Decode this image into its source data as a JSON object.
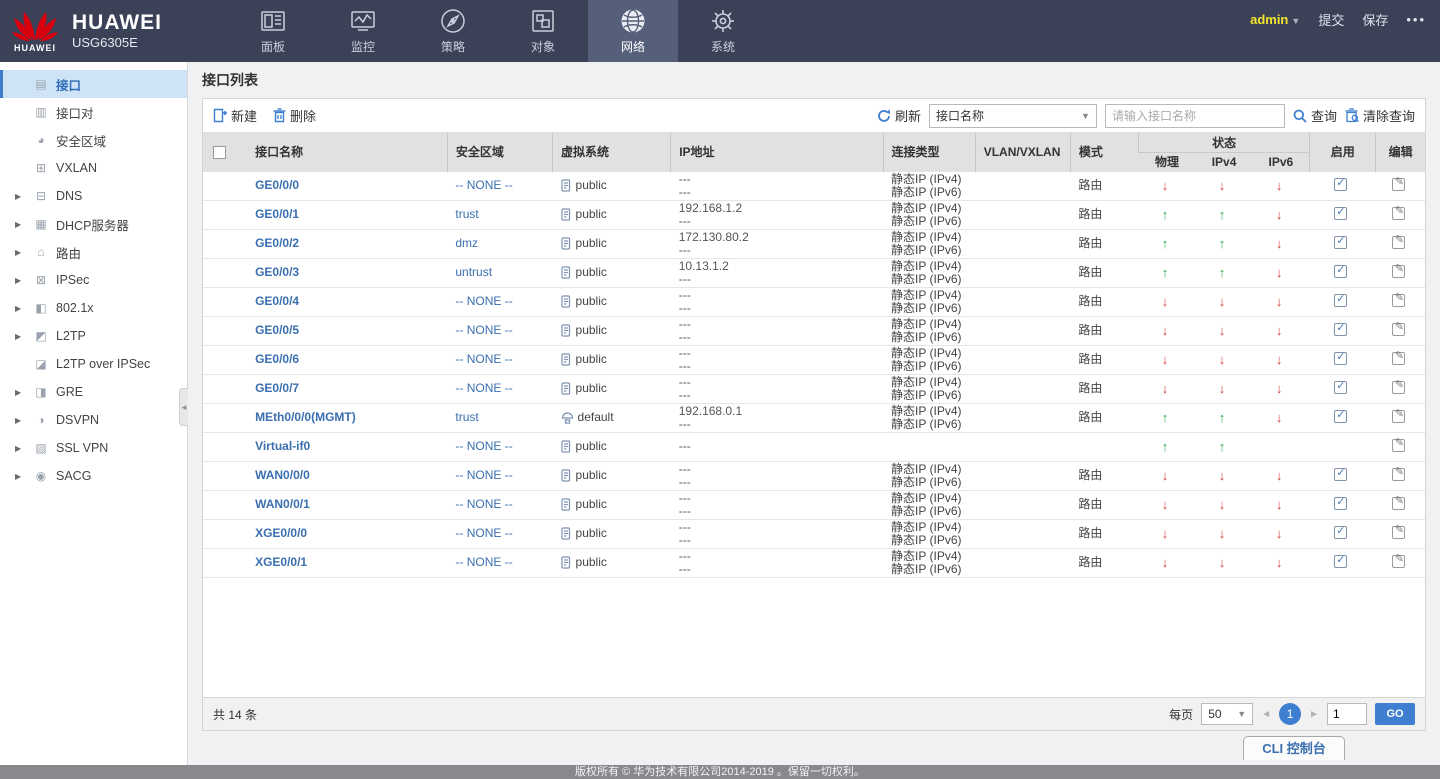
{
  "topbar": {
    "brand": "HUAWEI",
    "model": "USG6305E",
    "logo_caption": "HUAWEI",
    "nav": [
      {
        "label": "面板",
        "icon": "dashboard-icon"
      },
      {
        "label": "监控",
        "icon": "monitor-icon"
      },
      {
        "label": "策略",
        "icon": "policy-icon"
      },
      {
        "label": "对象",
        "icon": "objects-icon"
      },
      {
        "label": "网络",
        "icon": "network-icon",
        "active": true
      },
      {
        "label": "系统",
        "icon": "system-icon"
      }
    ],
    "user": "admin",
    "submit_label": "提交",
    "save_label": "保存",
    "more_label": "•••"
  },
  "sidebar": {
    "items": [
      {
        "label": "接口",
        "glyph": "▤",
        "expandable": false,
        "active": true
      },
      {
        "label": "接口对",
        "glyph": "▥",
        "expandable": false
      },
      {
        "label": "安全区域",
        "glyph": "◕",
        "expandable": false
      },
      {
        "label": "VXLAN",
        "glyph": "⊞",
        "expandable": false
      },
      {
        "label": "DNS",
        "glyph": "⊟",
        "expandable": true
      },
      {
        "label": "DHCP服务器",
        "glyph": "▦",
        "expandable": true
      },
      {
        "label": "路由",
        "glyph": "⌂",
        "expandable": true
      },
      {
        "label": "IPSec",
        "glyph": "⊠",
        "expandable": true
      },
      {
        "label": "802.1x",
        "glyph": "◧",
        "expandable": true
      },
      {
        "label": "L2TP",
        "glyph": "◩",
        "expandable": true
      },
      {
        "label": "L2TP over IPSec",
        "glyph": "◪",
        "expandable": false
      },
      {
        "label": "GRE",
        "glyph": "◨",
        "expandable": true
      },
      {
        "label": "DSVPN",
        "glyph": "◑",
        "expandable": true
      },
      {
        "label": "SSL VPN",
        "glyph": "▧",
        "expandable": true
      },
      {
        "label": "SACG",
        "glyph": "◉",
        "expandable": true
      }
    ]
  },
  "main": {
    "title": "接口列表",
    "toolbar": {
      "new_label": "新建",
      "delete_label": "删除",
      "refresh_label": "刷新",
      "filter_selected": "接口名称",
      "search_placeholder": "请输入接口名称",
      "query_label": "查询",
      "clear_label": "清除查询"
    },
    "table": {
      "col_interface": "接口名称",
      "col_zone": "安全区域",
      "col_vsys": "虚拟系统",
      "col_ip": "IP地址",
      "col_conn": "连接类型",
      "col_vlan": "VLAN/VXLAN",
      "col_mode": "模式",
      "col_status": "状态",
      "col_phy": "物理",
      "col_ipv4": "IPv4",
      "col_ipv6": "IPv6",
      "col_enable": "启用",
      "col_edit": "编辑",
      "rows": [
        {
          "name": "GE0/0/0",
          "zone": "-- NONE --",
          "vsys": "public",
          "vsys_is_public": true,
          "vsys_is_default": false,
          "ip1": "---",
          "ip2": "---",
          "conn1": "静态IP (IPv4)",
          "conn2": "静态IP (IPv6)",
          "vlan": "",
          "mode": "路由",
          "phy": "down",
          "ipv4": "down",
          "ipv6": "down",
          "enable": true
        },
        {
          "name": "GE0/0/1",
          "zone": "trust",
          "vsys": "public",
          "vsys_is_public": true,
          "vsys_is_default": false,
          "ip1": "192.168.1.2",
          "ip2": "---",
          "conn1": "静态IP (IPv4)",
          "conn2": "静态IP (IPv6)",
          "vlan": "",
          "mode": "路由",
          "phy": "up",
          "ipv4": "up",
          "ipv6": "down",
          "enable": true
        },
        {
          "name": "GE0/0/2",
          "zone": "dmz",
          "vsys": "public",
          "vsys_is_public": true,
          "vsys_is_default": false,
          "ip1": "172.130.80.2",
          "ip2": "---",
          "conn1": "静态IP (IPv4)",
          "conn2": "静态IP (IPv6)",
          "vlan": "",
          "mode": "路由",
          "phy": "up",
          "ipv4": "up",
          "ipv6": "down",
          "enable": true
        },
        {
          "name": "GE0/0/3",
          "zone": "untrust",
          "vsys": "public",
          "vsys_is_public": true,
          "vsys_is_default": false,
          "ip1": "10.13.1.2",
          "ip2": "---",
          "conn1": "静态IP (IPv4)",
          "conn2": "静态IP (IPv6)",
          "vlan": "",
          "mode": "路由",
          "phy": "up",
          "ipv4": "up",
          "ipv6": "down",
          "enable": true
        },
        {
          "name": "GE0/0/4",
          "zone": "-- NONE --",
          "vsys": "public",
          "vsys_is_public": true,
          "vsys_is_default": false,
          "ip1": "---",
          "ip2": "---",
          "conn1": "静态IP (IPv4)",
          "conn2": "静态IP (IPv6)",
          "vlan": "",
          "mode": "路由",
          "phy": "down",
          "ipv4": "down",
          "ipv6": "down",
          "enable": true
        },
        {
          "name": "GE0/0/5",
          "zone": "-- NONE --",
          "vsys": "public",
          "vsys_is_public": true,
          "vsys_is_default": false,
          "ip1": "---",
          "ip2": "---",
          "conn1": "静态IP (IPv4)",
          "conn2": "静态IP (IPv6)",
          "vlan": "",
          "mode": "路由",
          "phy": "down",
          "ipv4": "down",
          "ipv6": "down",
          "enable": true
        },
        {
          "name": "GE0/0/6",
          "zone": "-- NONE --",
          "vsys": "public",
          "vsys_is_public": true,
          "vsys_is_default": false,
          "ip1": "---",
          "ip2": "---",
          "conn1": "静态IP (IPv4)",
          "conn2": "静态IP (IPv6)",
          "vlan": "",
          "mode": "路由",
          "phy": "down",
          "ipv4": "down",
          "ipv6": "down",
          "enable": true
        },
        {
          "name": "GE0/0/7",
          "zone": "-- NONE --",
          "vsys": "public",
          "vsys_is_public": true,
          "vsys_is_default": false,
          "ip1": "---",
          "ip2": "---",
          "conn1": "静态IP (IPv4)",
          "conn2": "静态IP (IPv6)",
          "vlan": "",
          "mode": "路由",
          "phy": "down",
          "ipv4": "down",
          "ipv6": "down",
          "enable": true
        },
        {
          "name": "MEth0/0/0(MGMT)",
          "zone": "trust",
          "vsys": "default",
          "vsys_is_public": false,
          "vsys_is_default": true,
          "ip1": "192.168.0.1",
          "ip2": "---",
          "conn1": "静态IP (IPv4)",
          "conn2": "静态IP (IPv6)",
          "vlan": "",
          "mode": "路由",
          "phy": "up",
          "ipv4": "up",
          "ipv6": "down",
          "enable": true
        },
        {
          "name": "Virtual-if0",
          "zone": "-- NONE --",
          "vsys": "public",
          "vsys_is_public": true,
          "vsys_is_default": false,
          "ip1": "---",
          "ip2": "",
          "conn1": "",
          "conn2": "",
          "vlan": "",
          "mode": "",
          "phy": "up",
          "ipv4": "up",
          "ipv6": "",
          "enable": false
        },
        {
          "name": "WAN0/0/0",
          "zone": "-- NONE --",
          "vsys": "public",
          "vsys_is_public": true,
          "vsys_is_default": false,
          "ip1": "---",
          "ip2": "---",
          "conn1": "静态IP (IPv4)",
          "conn2": "静态IP (IPv6)",
          "vlan": "",
          "mode": "路由",
          "phy": "down",
          "ipv4": "down",
          "ipv6": "down",
          "enable": true
        },
        {
          "name": "WAN0/0/1",
          "zone": "-- NONE --",
          "vsys": "public",
          "vsys_is_public": true,
          "vsys_is_default": false,
          "ip1": "---",
          "ip2": "---",
          "conn1": "静态IP (IPv4)",
          "conn2": "静态IP (IPv6)",
          "vlan": "",
          "mode": "路由",
          "phy": "down",
          "ipv4": "down",
          "ipv6": "down",
          "enable": true
        },
        {
          "name": "XGE0/0/0",
          "zone": "-- NONE --",
          "vsys": "public",
          "vsys_is_public": true,
          "vsys_is_default": false,
          "ip1": "---",
          "ip2": "---",
          "conn1": "静态IP (IPv4)",
          "conn2": "静态IP (IPv6)",
          "vlan": "",
          "mode": "路由",
          "phy": "down",
          "ipv4": "down",
          "ipv6": "down",
          "enable": true
        },
        {
          "name": "XGE0/0/1",
          "zone": "-- NONE --",
          "vsys": "public",
          "vsys_is_public": true,
          "vsys_is_default": false,
          "ip1": "---",
          "ip2": "---",
          "conn1": "静态IP (IPv4)",
          "conn2": "静态IP (IPv6)",
          "vlan": "",
          "mode": "路由",
          "phy": "down",
          "ipv4": "down",
          "ipv6": "down",
          "enable": true
        }
      ]
    },
    "pagination": {
      "total": "共 14 条",
      "per_page_label": "每页",
      "per_page": "50",
      "page": "1",
      "goto_value": "1",
      "go_label": "GO"
    },
    "cli_label": "CLI 控制台"
  },
  "footer": {
    "copyright": "版权所有 © 华为技术有限公司2014-2019 。保留一切权利。"
  },
  "colors": {
    "accent_blue": "#3e7fd1",
    "up_green": "#2aa64e",
    "down_red": "#d4403c",
    "topbar_bg": "#3b4257",
    "active_tab_bg": "#565f79"
  }
}
